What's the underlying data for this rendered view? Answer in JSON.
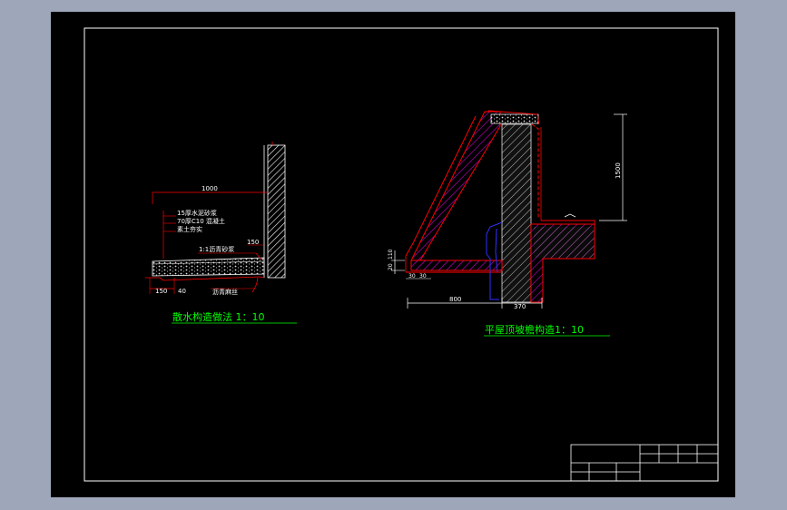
{
  "colors": {
    "window_bg": "#9ea6ba",
    "paper": "#000000",
    "frame": "#ffffff",
    "section_line": "#ff0000",
    "hatch": "#c000c0",
    "blue_line": "#3030ff",
    "title_green": "#00ff00",
    "note_text": "#ffffff"
  },
  "drawing_left": {
    "title": "散水构造做法 1：10",
    "dim_width": "1000",
    "layer_1": "15厚水泥砂浆",
    "layer_2": "70厚C10 混凝土",
    "layer_3": "素土夯实",
    "note_joint": "1:1沥青砂浆",
    "dim_150_top": "150",
    "dim_150_bottom": "150",
    "dim_40": "40",
    "note_rope": "沥青麻丝"
  },
  "drawing_right": {
    "title": "平屋顶坡檐构造1：10",
    "dim_1500": "1500",
    "dim_110": "110",
    "dim_20": "20",
    "dim_30a": "30",
    "dim_30b": "30",
    "dim_800": "800",
    "dim_370": "370"
  }
}
